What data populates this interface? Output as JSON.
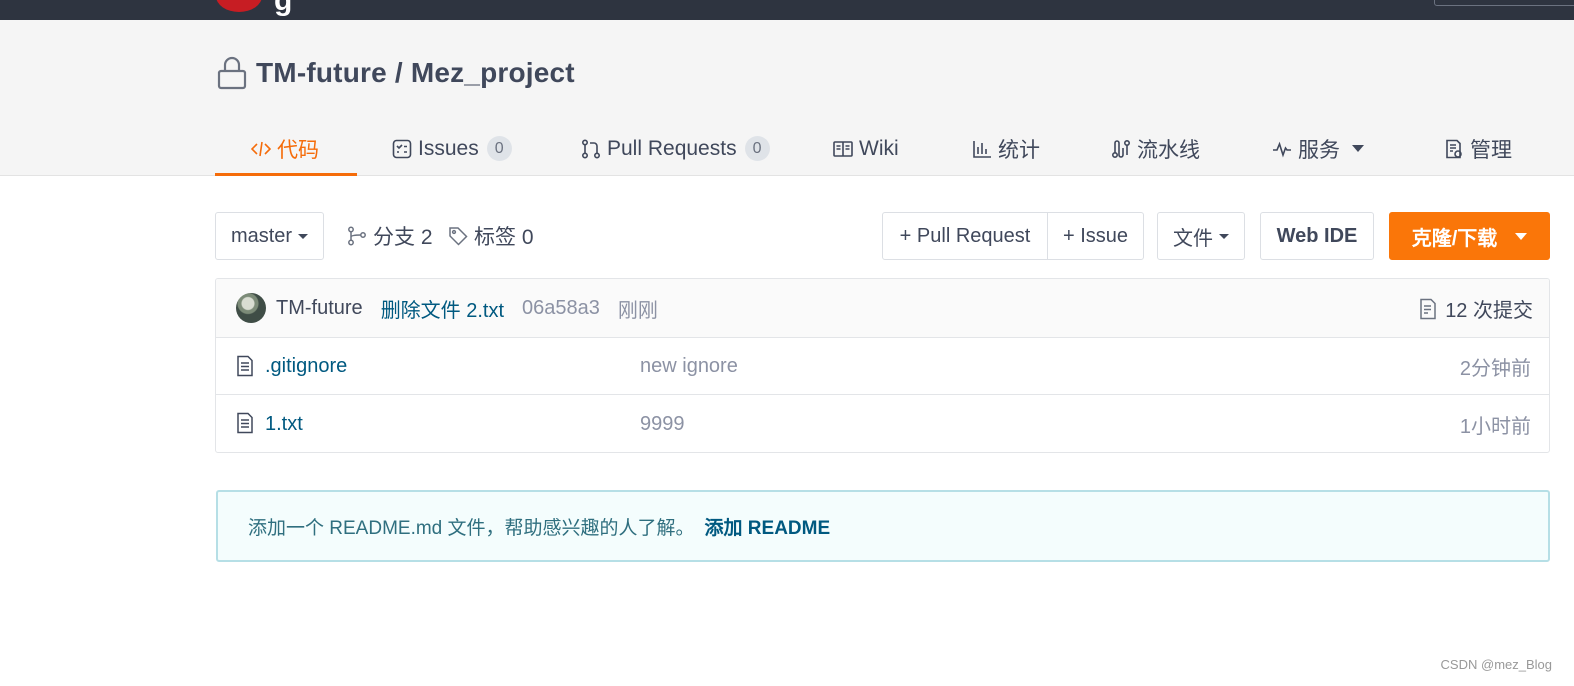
{
  "repo": {
    "title": "TM-future / Mez_project"
  },
  "tabs": [
    {
      "label": "代码",
      "icon": "code-icon"
    },
    {
      "label": "Issues",
      "count": "0",
      "icon": "issues-icon"
    },
    {
      "label": "Pull Requests",
      "count": "0",
      "icon": "pull-request-icon"
    },
    {
      "label": "Wiki",
      "icon": "book-icon"
    },
    {
      "label": "统计",
      "icon": "bar-chart-icon"
    },
    {
      "label": "流水线",
      "icon": "pipeline-icon"
    },
    {
      "label": "服务",
      "icon": "pulse-icon"
    },
    {
      "label": "管理",
      "icon": "settings-doc-icon"
    }
  ],
  "toolbar": {
    "branch": "master",
    "branches": "分支 2",
    "tags": "标签 0",
    "new_pull_request": "+ Pull Request",
    "new_issue": "+ Issue",
    "files": "文件",
    "web_ide": "Web IDE",
    "clone_download": "克隆/下载"
  },
  "commit": {
    "author": "TM-future",
    "message": "删除文件 2.txt",
    "hash": "06a58a3",
    "time": "刚刚",
    "count": "12 次提交"
  },
  "files": [
    {
      "name": ".gitignore",
      "commit": "new ignore",
      "time": "2分钟前"
    },
    {
      "name": "1.txt",
      "commit": "9999",
      "time": "1小时前"
    }
  ],
  "readme": {
    "tip": "添加一个 README.md 文件，帮助感兴趣的人了解。",
    "add_link": "添加 README"
  },
  "watermark": "CSDN @mez_Blog",
  "colors": {
    "accent": "#f56c0a",
    "primary_button": "#fa7609",
    "link": "#005980",
    "topbar": "#2e3440"
  }
}
